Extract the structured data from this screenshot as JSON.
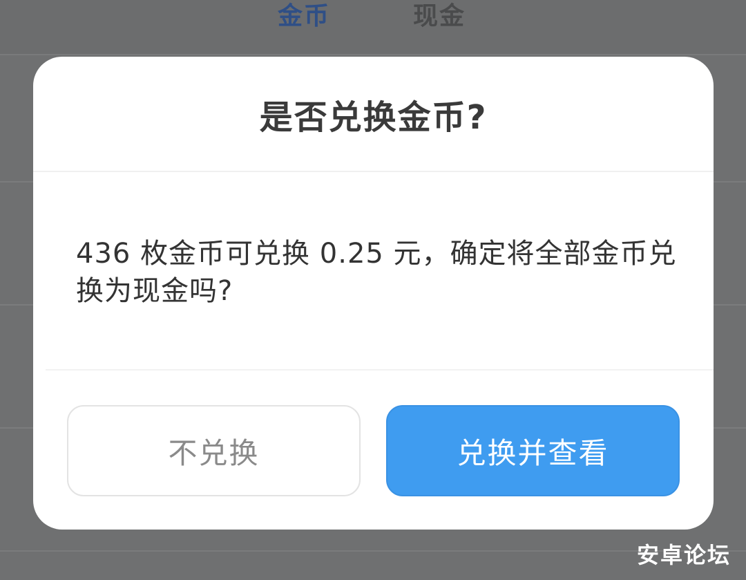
{
  "background": {
    "tabs": [
      {
        "label": "金币",
        "active": true
      },
      {
        "label": "现金",
        "active": false
      }
    ],
    "accent_color": "#2f4f86"
  },
  "dialog": {
    "title": "是否兑换金币?",
    "message": "436 枚金币可兑换 0.25 元，确定将全部金币兑换为现金吗?",
    "cancel_label": "不兑换",
    "confirm_label": "兑换并查看",
    "confirm_color": "#3f9cf0"
  },
  "watermark": "安卓论坛"
}
